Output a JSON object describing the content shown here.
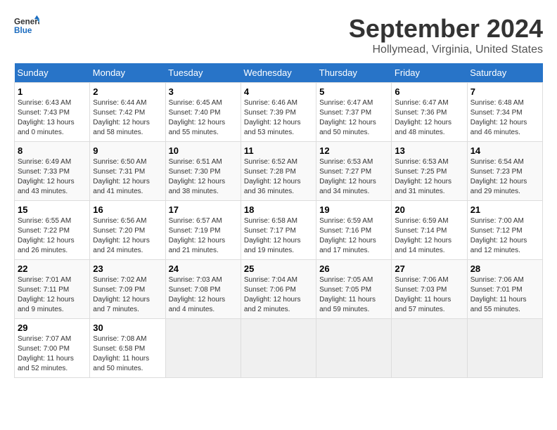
{
  "header": {
    "logo_line1": "General",
    "logo_line2": "Blue",
    "month": "September 2024",
    "location": "Hollymead, Virginia, United States"
  },
  "days_of_week": [
    "Sunday",
    "Monday",
    "Tuesday",
    "Wednesday",
    "Thursday",
    "Friday",
    "Saturday"
  ],
  "weeks": [
    [
      {
        "day": "1",
        "sunrise": "6:43 AM",
        "sunset": "7:43 PM",
        "daylight": "13 hours and 0 minutes."
      },
      {
        "day": "2",
        "sunrise": "6:44 AM",
        "sunset": "7:42 PM",
        "daylight": "12 hours and 58 minutes."
      },
      {
        "day": "3",
        "sunrise": "6:45 AM",
        "sunset": "7:40 PM",
        "daylight": "12 hours and 55 minutes."
      },
      {
        "day": "4",
        "sunrise": "6:46 AM",
        "sunset": "7:39 PM",
        "daylight": "12 hours and 53 minutes."
      },
      {
        "day": "5",
        "sunrise": "6:47 AM",
        "sunset": "7:37 PM",
        "daylight": "12 hours and 50 minutes."
      },
      {
        "day": "6",
        "sunrise": "6:47 AM",
        "sunset": "7:36 PM",
        "daylight": "12 hours and 48 minutes."
      },
      {
        "day": "7",
        "sunrise": "6:48 AM",
        "sunset": "7:34 PM",
        "daylight": "12 hours and 46 minutes."
      }
    ],
    [
      {
        "day": "8",
        "sunrise": "6:49 AM",
        "sunset": "7:33 PM",
        "daylight": "12 hours and 43 minutes."
      },
      {
        "day": "9",
        "sunrise": "6:50 AM",
        "sunset": "7:31 PM",
        "daylight": "12 hours and 41 minutes."
      },
      {
        "day": "10",
        "sunrise": "6:51 AM",
        "sunset": "7:30 PM",
        "daylight": "12 hours and 38 minutes."
      },
      {
        "day": "11",
        "sunrise": "6:52 AM",
        "sunset": "7:28 PM",
        "daylight": "12 hours and 36 minutes."
      },
      {
        "day": "12",
        "sunrise": "6:53 AM",
        "sunset": "7:27 PM",
        "daylight": "12 hours and 34 minutes."
      },
      {
        "day": "13",
        "sunrise": "6:53 AM",
        "sunset": "7:25 PM",
        "daylight": "12 hours and 31 minutes."
      },
      {
        "day": "14",
        "sunrise": "6:54 AM",
        "sunset": "7:23 PM",
        "daylight": "12 hours and 29 minutes."
      }
    ],
    [
      {
        "day": "15",
        "sunrise": "6:55 AM",
        "sunset": "7:22 PM",
        "daylight": "12 hours and 26 minutes."
      },
      {
        "day": "16",
        "sunrise": "6:56 AM",
        "sunset": "7:20 PM",
        "daylight": "12 hours and 24 minutes."
      },
      {
        "day": "17",
        "sunrise": "6:57 AM",
        "sunset": "7:19 PM",
        "daylight": "12 hours and 21 minutes."
      },
      {
        "day": "18",
        "sunrise": "6:58 AM",
        "sunset": "7:17 PM",
        "daylight": "12 hours and 19 minutes."
      },
      {
        "day": "19",
        "sunrise": "6:59 AM",
        "sunset": "7:16 PM",
        "daylight": "12 hours and 17 minutes."
      },
      {
        "day": "20",
        "sunrise": "6:59 AM",
        "sunset": "7:14 PM",
        "daylight": "12 hours and 14 minutes."
      },
      {
        "day": "21",
        "sunrise": "7:00 AM",
        "sunset": "7:12 PM",
        "daylight": "12 hours and 12 minutes."
      }
    ],
    [
      {
        "day": "22",
        "sunrise": "7:01 AM",
        "sunset": "7:11 PM",
        "daylight": "12 hours and 9 minutes."
      },
      {
        "day": "23",
        "sunrise": "7:02 AM",
        "sunset": "7:09 PM",
        "daylight": "12 hours and 7 minutes."
      },
      {
        "day": "24",
        "sunrise": "7:03 AM",
        "sunset": "7:08 PM",
        "daylight": "12 hours and 4 minutes."
      },
      {
        "day": "25",
        "sunrise": "7:04 AM",
        "sunset": "7:06 PM",
        "daylight": "12 hours and 2 minutes."
      },
      {
        "day": "26",
        "sunrise": "7:05 AM",
        "sunset": "7:05 PM",
        "daylight": "11 hours and 59 minutes."
      },
      {
        "day": "27",
        "sunrise": "7:06 AM",
        "sunset": "7:03 PM",
        "daylight": "11 hours and 57 minutes."
      },
      {
        "day": "28",
        "sunrise": "7:06 AM",
        "sunset": "7:01 PM",
        "daylight": "11 hours and 55 minutes."
      }
    ],
    [
      {
        "day": "29",
        "sunrise": "7:07 AM",
        "sunset": "7:00 PM",
        "daylight": "11 hours and 52 minutes."
      },
      {
        "day": "30",
        "sunrise": "7:08 AM",
        "sunset": "6:58 PM",
        "daylight": "11 hours and 50 minutes."
      },
      null,
      null,
      null,
      null,
      null
    ]
  ],
  "labels": {
    "sunrise": "Sunrise:",
    "sunset": "Sunset:",
    "daylight": "Daylight:"
  }
}
